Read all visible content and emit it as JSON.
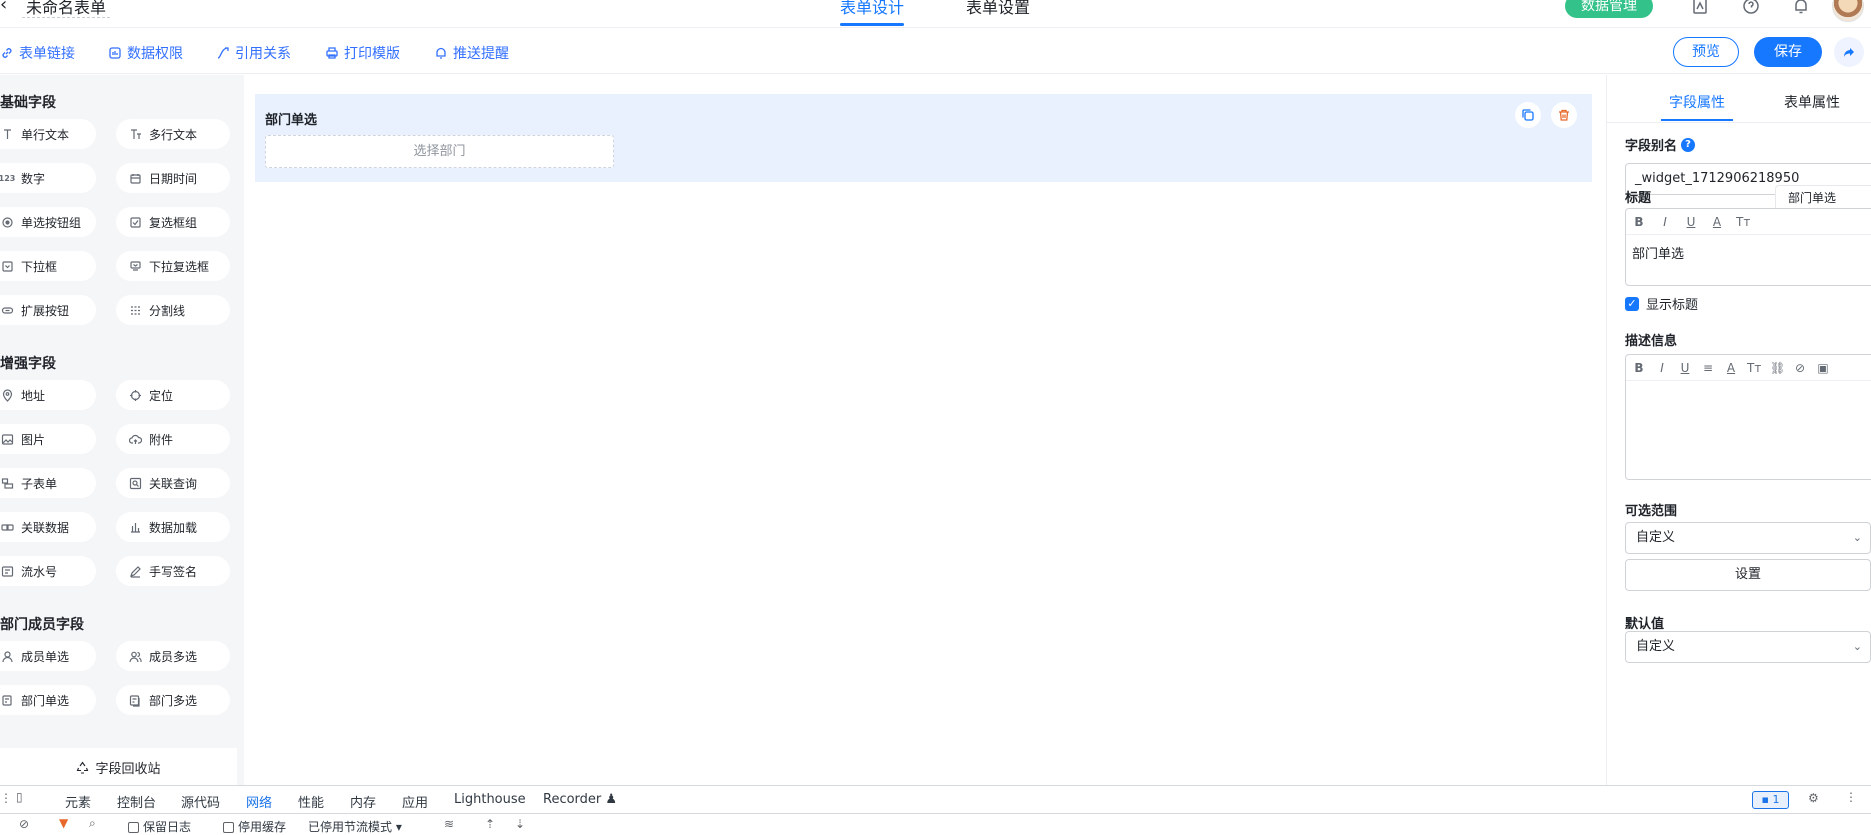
{
  "header": {
    "form_name": "未命名表单",
    "tabs": [
      {
        "label": "表单设计"
      },
      {
        "label": "表单设置"
      }
    ],
    "data_mgmt_label": "数据管理"
  },
  "toolbar": {
    "links": [
      {
        "label": "表单链接"
      },
      {
        "label": "数据权限"
      },
      {
        "label": "引用关系"
      },
      {
        "label": "打印模版"
      },
      {
        "label": "推送提醒"
      }
    ],
    "preview_label": "预览",
    "save_label": "保存"
  },
  "palette": {
    "groups": [
      {
        "title": "基础字段",
        "items": [
          {
            "label": "单行文本",
            "icon": "text-icon"
          },
          {
            "label": "多行文本",
            "icon": "multiline-text-icon"
          },
          {
            "label": "数字",
            "icon": "number-icon"
          },
          {
            "label": "日期时间",
            "icon": "calendar-icon"
          },
          {
            "label": "单选按钮组",
            "icon": "radio-icon"
          },
          {
            "label": "复选框组",
            "icon": "checkbox-icon"
          },
          {
            "label": "下拉框",
            "icon": "dropdown-icon"
          },
          {
            "label": "下拉复选框",
            "icon": "dropdown-multi-icon"
          },
          {
            "label": "扩展按钮",
            "icon": "link-button-icon"
          },
          {
            "label": "分割线",
            "icon": "divider-icon"
          }
        ]
      },
      {
        "title": "增强字段",
        "items": [
          {
            "label": "地址",
            "icon": "location-pin-icon"
          },
          {
            "label": "定位",
            "icon": "crosshair-icon"
          },
          {
            "label": "图片",
            "icon": "image-icon"
          },
          {
            "label": "附件",
            "icon": "cloud-upload-icon"
          },
          {
            "label": "子表单",
            "icon": "subform-icon"
          },
          {
            "label": "关联查询",
            "icon": "related-query-icon"
          },
          {
            "label": "关联数据",
            "icon": "related-data-icon"
          },
          {
            "label": "数据加载",
            "icon": "bar-chart-icon"
          },
          {
            "label": "流水号",
            "icon": "serial-number-icon"
          },
          {
            "label": "手写签名",
            "icon": "pen-icon"
          }
        ]
      },
      {
        "title": "部门成员字段",
        "items": [
          {
            "label": "成员单选",
            "icon": "user-icon"
          },
          {
            "label": "成员多选",
            "icon": "users-icon"
          },
          {
            "label": "部门单选",
            "icon": "department-icon"
          },
          {
            "label": "部门多选",
            "icon": "departments-icon"
          }
        ]
      }
    ],
    "recycle_label": "字段回收站"
  },
  "canvas": {
    "field_title": "部门单选",
    "field_placeholder": "选择部门"
  },
  "props": {
    "tabs": [
      {
        "label": "字段属性"
      },
      {
        "label": "表单属性"
      }
    ],
    "alias_label": "字段别名",
    "alias_value": "_widget_1712906218950",
    "title_label": "标题",
    "title_chip": "部门单选",
    "title_toolbar": [
      "B",
      "I",
      "U",
      "A",
      "Tт"
    ],
    "title_value": "部门单选",
    "show_title_label": "显示标题",
    "desc_label": "描述信息",
    "desc_toolbar": [
      "B",
      "I",
      "U",
      "≡",
      "A",
      "Tт",
      "⛓",
      "⊘",
      "▣"
    ],
    "desc_value": "",
    "range_label": "可选范围",
    "range_value": "自定义",
    "set_button": "设置",
    "default_label": "默认值",
    "default_value": "自定义"
  },
  "devtools": {
    "tabs": [
      {
        "label": "元素"
      },
      {
        "label": "控制台"
      },
      {
        "label": "源代码"
      },
      {
        "label": "网络"
      },
      {
        "label": "性能"
      },
      {
        "label": "内存"
      },
      {
        "label": "应用"
      },
      {
        "label": "Lighthouse"
      },
      {
        "label": "Recorder ♟"
      }
    ],
    "issues_count": "1",
    "preserve_log": "保留日志",
    "disable_cache": "停用缓存",
    "throttling": "已停用节流模式"
  },
  "colors": {
    "accent": "#1677ff",
    "data_mgmt": "#33c28a",
    "field_card_bg": "#e8f1fd",
    "palette_bg": "#f5f6f8"
  }
}
